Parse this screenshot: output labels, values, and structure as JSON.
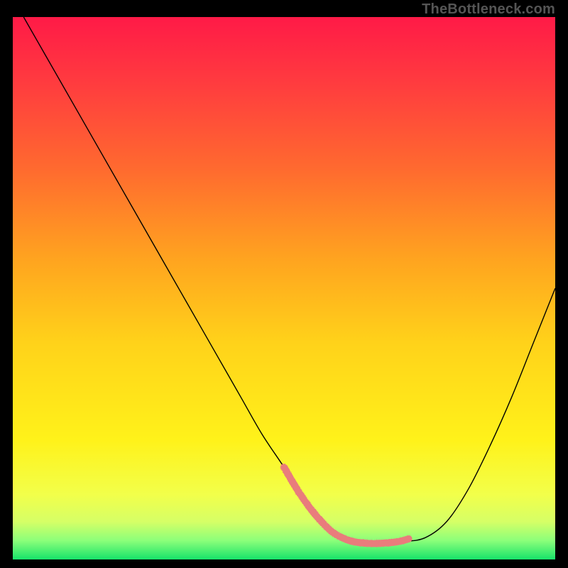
{
  "watermark": "TheBottleneck.com",
  "chart_data": {
    "type": "line",
    "title": "",
    "xlabel": "",
    "ylabel": "",
    "xlim": [
      0,
      100
    ],
    "ylim": [
      0,
      100
    ],
    "grid": false,
    "legend": false,
    "gradient_stops": [
      {
        "offset": 0.0,
        "color": "#ff1a47"
      },
      {
        "offset": 0.12,
        "color": "#ff3b3f"
      },
      {
        "offset": 0.28,
        "color": "#ff6a2f"
      },
      {
        "offset": 0.45,
        "color": "#ffa51f"
      },
      {
        "offset": 0.6,
        "color": "#ffd21a"
      },
      {
        "offset": 0.78,
        "color": "#fff21a"
      },
      {
        "offset": 0.88,
        "color": "#f2ff4a"
      },
      {
        "offset": 0.93,
        "color": "#d6ff66"
      },
      {
        "offset": 0.965,
        "color": "#8cff7a"
      },
      {
        "offset": 1.0,
        "color": "#17e36a"
      }
    ],
    "series": [
      {
        "name": "bottleneck-curve",
        "color": "#000000",
        "stroke_width": 1.4,
        "x": [
          2,
          6,
          10,
          14,
          18,
          22,
          26,
          30,
          34,
          38,
          42,
          46,
          50,
          53,
          56,
          59,
          62,
          65,
          68,
          72,
          76,
          80,
          84,
          88,
          92,
          96,
          100
        ],
        "y": [
          100,
          93,
          86,
          79,
          72,
          65,
          58,
          51,
          44,
          37,
          30,
          23,
          17,
          12,
          8,
          5,
          3.5,
          3,
          3,
          3.3,
          4,
          7,
          13,
          21,
          30,
          40,
          50
        ]
      }
    ],
    "highlight_band": {
      "name": "optimal-range",
      "color": "#e97b7b",
      "stroke_width": 10,
      "x": [
        50,
        53,
        56,
        59,
        62,
        65,
        68,
        71,
        73
      ],
      "y": [
        17,
        12,
        8,
        5,
        3.5,
        3,
        3,
        3.3,
        3.8
      ]
    }
  }
}
